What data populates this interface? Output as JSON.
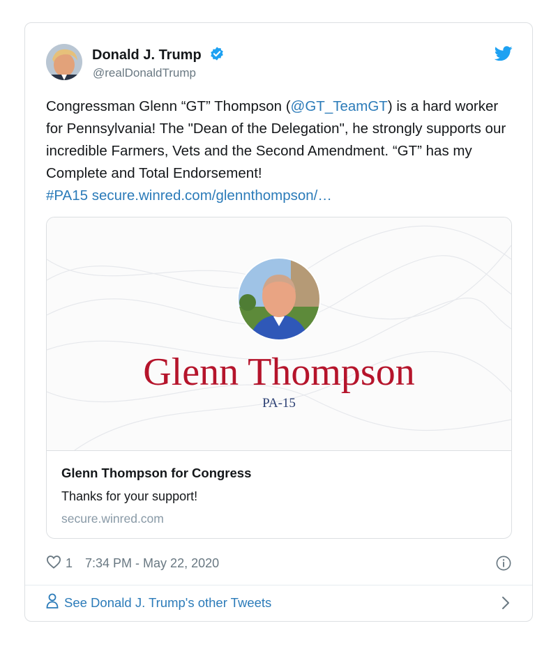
{
  "tweet": {
    "author_name": "Donald J. Trump",
    "handle": "@realDonaldTrump",
    "text": {
      "part1": "Congressman Glenn “GT” Thompson (",
      "mention": "@GT_TeamGT",
      "part2": ") is a hard worker for Pennsylvania! The \"Dean of the Delegation\", he strongly supports our incredible Farmers, Vets and the Second Amendment. “GT” has my Complete and Total Endorsement!",
      "hashtag": "#PA15",
      "url": "secure.winred.com/glennthompson/…"
    },
    "like_count": "1",
    "timestamp": "7:34 PM - May 22, 2020",
    "footer_link": "See Donald J. Trump's other Tweets"
  },
  "card": {
    "banner_name": "Glenn Thompson",
    "banner_district": "PA-15",
    "title": "Glenn Thompson for Congress",
    "description": "Thanks for your support!",
    "domain": "secure.winred.com"
  },
  "icons": {
    "verified": "verified-badge-icon",
    "twitter": "twitter-bird-icon",
    "like": "heart-icon",
    "info": "info-icon",
    "person": "person-icon",
    "chevron": "chevron-right-icon"
  },
  "colors": {
    "link": "#2b7bb9",
    "verified": "#1da1f2",
    "banner_name": "#b5142b",
    "banner_district": "#2b3f73"
  }
}
